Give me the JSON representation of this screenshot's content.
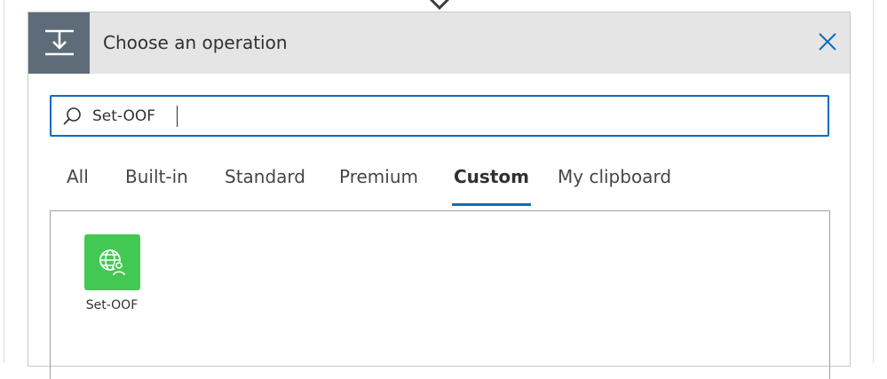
{
  "dialog": {
    "title": "Choose an operation",
    "header_icon": "insert-operation-icon",
    "close_icon": "close-icon"
  },
  "search": {
    "value": "Set-OOF",
    "placeholder": "",
    "icon": "search-icon"
  },
  "tabs": [
    {
      "label": "All",
      "active": false
    },
    {
      "label": "Built-in",
      "active": false
    },
    {
      "label": "Standard",
      "active": false
    },
    {
      "label": "Premium",
      "active": false
    },
    {
      "label": "Custom",
      "active": true
    },
    {
      "label": "My clipboard",
      "active": false
    }
  ],
  "results": [
    {
      "label": "Set-OOF",
      "icon": "globe-user-icon",
      "color": "#43c853"
    }
  ],
  "colors": {
    "accent": "#0f6cbd",
    "header_bg": "#e5e5e5",
    "header_icon_bg": "#5e6b79",
    "tile_green": "#43c853"
  }
}
